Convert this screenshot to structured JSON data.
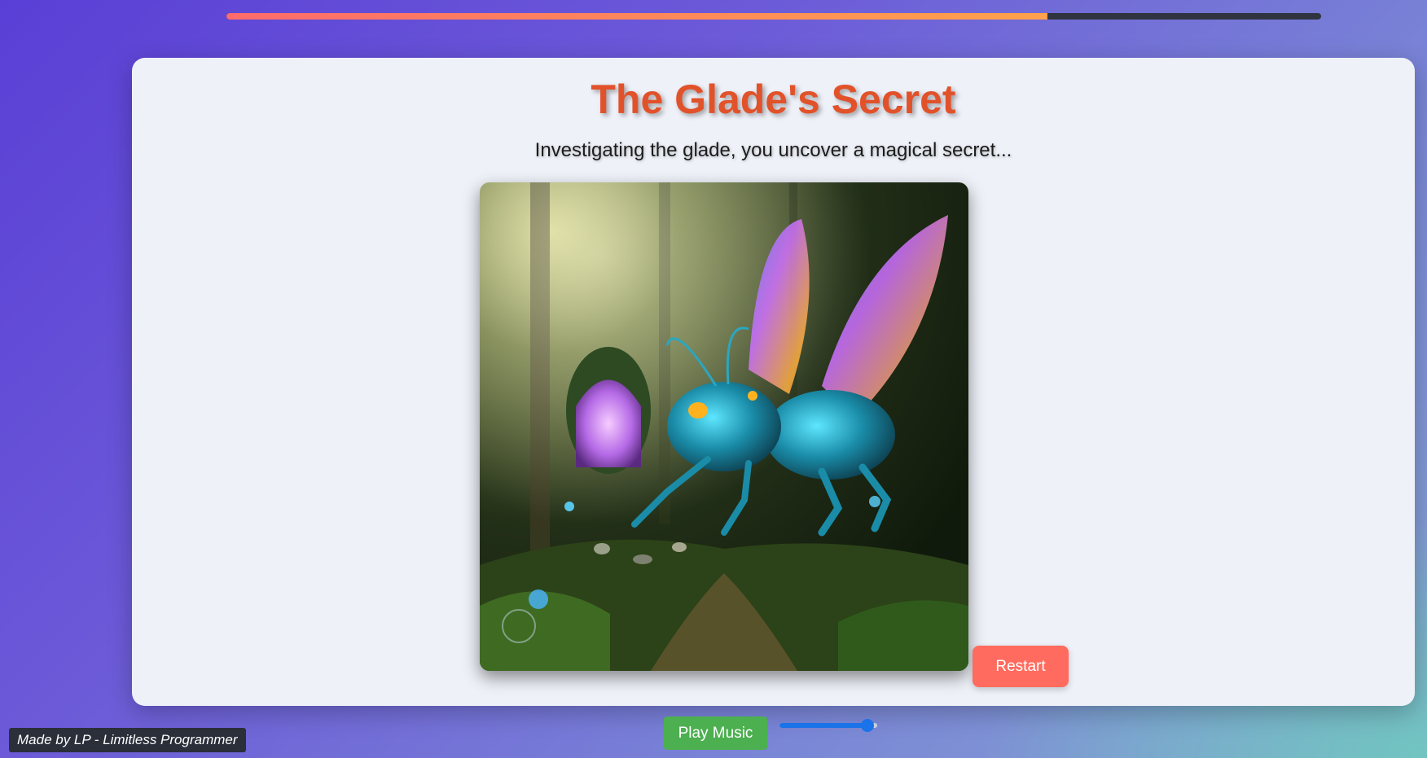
{
  "progress": {
    "fraction": 0.75
  },
  "card": {
    "title": "The Glade's Secret",
    "subtitle": "Investigating the glade, you uncover a magical secret..."
  },
  "scene_image": {
    "subject": "glowing winged insect creature in an enchanted forest near a purple portal"
  },
  "restart_label": "Restart",
  "music": {
    "play_label": "Play Music",
    "volume": 0.9
  },
  "footer": {
    "credit": "Made by LP - Limitless Programmer"
  },
  "colors": {
    "title": "#e2522a",
    "restart": "#ff6b5e",
    "play": "#4caf50",
    "slider": "#1a73e8"
  }
}
